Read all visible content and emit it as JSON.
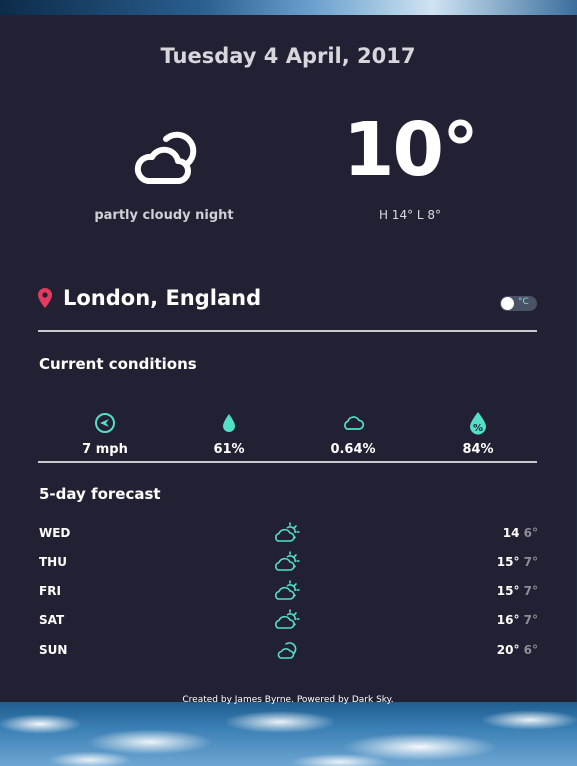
{
  "date": "Tuesday 4 April, 2017",
  "current": {
    "icon": "partly-cloudy-night-icon",
    "summary": "partly cloudy night",
    "temperature": "10°",
    "high_low": "H 14° L 8°"
  },
  "location": {
    "name": "London, England",
    "unit_toggle": "°C"
  },
  "conditions": {
    "title": "Current conditions",
    "items": [
      {
        "icon": "wind-icon",
        "value": "7 mph"
      },
      {
        "icon": "humidity-drop-icon",
        "value": "61%"
      },
      {
        "icon": "cloud-cover-icon",
        "value": "0.64%"
      },
      {
        "icon": "precipitation-percent-icon",
        "value": "84%"
      }
    ]
  },
  "forecast": {
    "title": "5-day forecast",
    "days": [
      {
        "day": "WED",
        "icon": "partly-cloudy-day-icon",
        "high": "14",
        "low": "6°"
      },
      {
        "day": "THU",
        "icon": "partly-cloudy-day-icon",
        "high": "15°",
        "low": "7°"
      },
      {
        "day": "FRI",
        "icon": "partly-cloudy-day-icon",
        "high": "15°",
        "low": "7°"
      },
      {
        "day": "SAT",
        "icon": "partly-cloudy-day-icon",
        "high": "16°",
        "low": "7°"
      },
      {
        "day": "SUN",
        "icon": "partly-cloudy-night-icon",
        "high": "20°",
        "low": "6°"
      }
    ]
  },
  "credit": {
    "prefix": "Created by",
    "author": "James Byrne",
    "middle": ". Powered by",
    "provider": "Dark Sky",
    "suffix": "."
  },
  "colors": {
    "accent": "#53e0c9",
    "pin": "#e33a5e",
    "card": "#222133"
  }
}
